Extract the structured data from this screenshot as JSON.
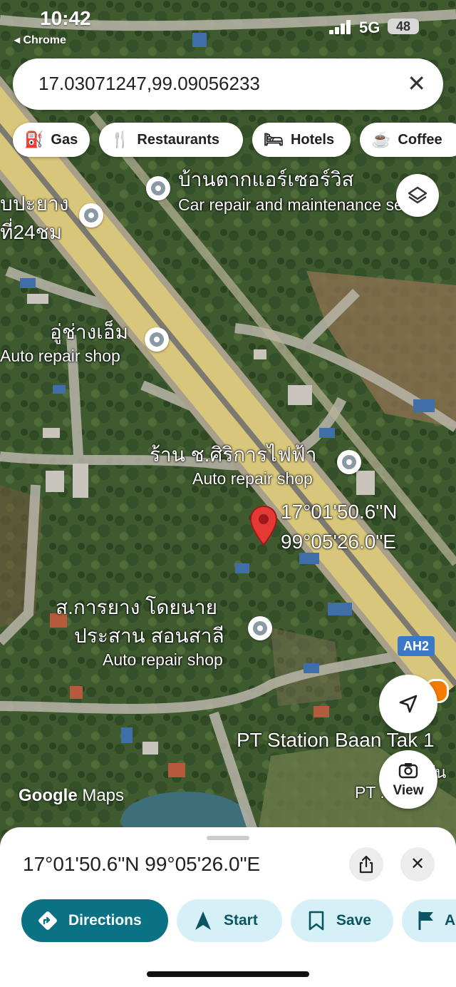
{
  "status_bar": {
    "time": "10:42",
    "back_app": "◂ Chrome",
    "network": "5G",
    "battery": "48"
  },
  "search": {
    "query": "17.03071247,99.09056233",
    "clear_icon": "close-icon"
  },
  "chips": [
    {
      "label": "Gas",
      "icon": "gas-station-icon"
    },
    {
      "label": "Restaurants",
      "icon": "fork-knife-icon"
    },
    {
      "label": "Hotels",
      "icon": "bed-icon"
    },
    {
      "label": "Coffee",
      "icon": "coffee-cup-icon"
    }
  ],
  "map": {
    "places": [
      {
        "name": "บ้านตากแอร์เซอร์วิส",
        "category": "Car repair and maintenance servic"
      },
      {
        "name": "บปะยาง",
        "name2": "ที่24ชม"
      },
      {
        "name": "อู่ช่างเอ็ม",
        "category": "Auto repair shop"
      },
      {
        "name": "ร้าน ช.ศิริการไฟฟ้า",
        "category": "Auto repair shop"
      },
      {
        "name": "ส.การยาง โดยนาย",
        "name2": "ประสาน สอนสาลี",
        "category": "Auto repair shop"
      },
      {
        "name": "PT Station Baan Tak 1",
        "category": "PT ... 1",
        "extra": "บัน"
      }
    ],
    "pin": {
      "lat": "17°01'50.6\"N",
      "lng": "99°05'26.0\"E",
      "color": "#e53935"
    },
    "route_shield": "AH2",
    "attribution": {
      "google": "Google",
      "maps": "Maps"
    },
    "view_button": "View"
  },
  "sheet": {
    "title": "17°01'50.6\"N 99°05'26.0\"E",
    "actions": [
      {
        "label": "Directions",
        "icon": "directions-icon",
        "primary": true
      },
      {
        "label": "Start",
        "icon": "navigation-arrow-icon"
      },
      {
        "label": "Save",
        "icon": "bookmark-icon"
      },
      {
        "label": "A",
        "icon": "flag-icon"
      }
    ]
  },
  "colors": {
    "primary": "#0b7285",
    "chip_bg": "#d5f1f7",
    "pin": "#e53935",
    "road": "#d8c77a"
  }
}
